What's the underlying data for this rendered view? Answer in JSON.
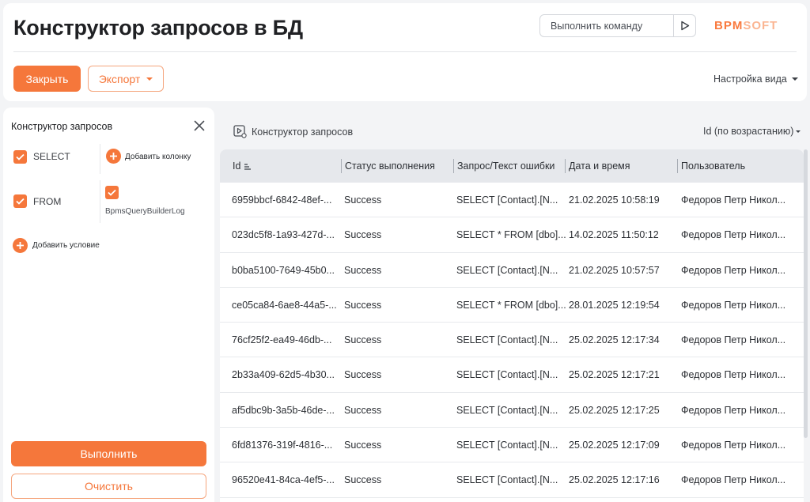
{
  "header": {
    "title": "Конструктор запросов в БД",
    "command_placeholder": "Выполнить команду",
    "logo_main": "ΒΡΜ",
    "logo_soft": "SOFT",
    "close_label": "Закрыть",
    "export_label": "Экспорт",
    "view_settings_label": "Настройка вида"
  },
  "builder": {
    "title": "Конструктор запросов",
    "select_label": "SELECT",
    "add_column_label": "Добавить колонку",
    "from_label": "FROM",
    "table_name": "BpmsQueryBuilderLog",
    "add_condition_label": "Добавить условие",
    "run_label": "Выполнить",
    "clear_label": "Очистить"
  },
  "results": {
    "title": "Конструктор запросов",
    "sort_label": "Id (по возрастанию)",
    "columns": [
      "Id",
      "Статус выполнения",
      "Запрос/Текст ошибки",
      "Дата и время",
      "Пользователь"
    ],
    "rows": [
      [
        "6959bbcf-6842-48ef-...",
        "Success",
        "SELECT [Contact].[N...",
        "21.02.2025 10:58:19",
        "Федоров Петр Никол..."
      ],
      [
        "023dc5f8-1a93-427d-...",
        "Success",
        "SELECT * FROM [dbo]...",
        "14.02.2025 11:50:12",
        "Федоров Петр Никол..."
      ],
      [
        "b0ba5100-7649-45b0...",
        "Success",
        "SELECT [Contact].[N...",
        "21.02.2025 10:57:57",
        "Федоров Петр Никол..."
      ],
      [
        "ce05ca84-6ae8-44a5-...",
        "Success",
        "SELECT * FROM [dbo]...",
        "28.01.2025 12:19:54",
        "Федоров Петр Никол..."
      ],
      [
        "76cf25f2-ea49-46db-...",
        "Success",
        "SELECT [Contact].[N...",
        "25.02.2025 12:17:34",
        "Федоров Петр Никол..."
      ],
      [
        "2b33a409-62d5-4b30...",
        "Success",
        "SELECT [Contact].[N...",
        "25.02.2025 12:17:21",
        "Федоров Петр Никол..."
      ],
      [
        "af5dbc9b-3a5b-46de-...",
        "Success",
        "SELECT [Contact].[N...",
        "25.02.2025 12:17:25",
        "Федоров Петр Никол..."
      ],
      [
        "6fd81376-319f-4816-...",
        "Success",
        "SELECT [Contact].[N...",
        "25.02.2025 12:17:09",
        "Федоров Петр Никол..."
      ],
      [
        "96520e41-84ca-4ef5-...",
        "Success",
        "SELECT [Contact].[N...",
        "25.02.2025 12:17:16",
        "Федоров Петр Никол..."
      ]
    ]
  },
  "colors": {
    "accent": "#f5773b",
    "accent_border": "#f5a57d",
    "header_row_bg": "#e6e8ec",
    "page_bg": "#f3f4f6"
  },
  "icons": {
    "run_command": "play-icon",
    "close_panel": "close-icon",
    "checkbox": "checkmark-icon",
    "add": "plus-icon",
    "sort_asc": "sort-ascending-icon",
    "results_title": "query-builder-icon",
    "dropdown": "chevron-down-icon"
  }
}
